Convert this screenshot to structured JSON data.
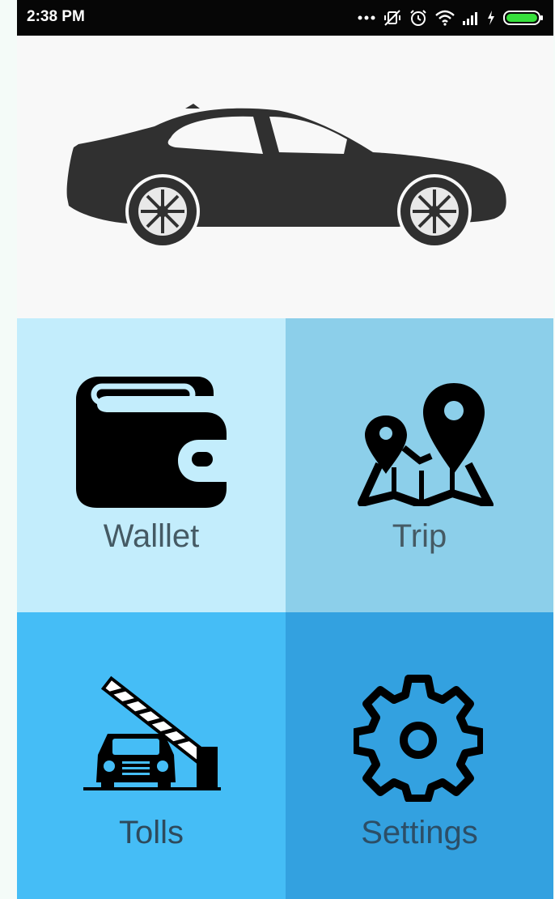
{
  "status_bar": {
    "time": "2:38 PM",
    "icons": [
      "more-dots-icon",
      "vibrate-off-icon",
      "alarm-icon",
      "wifi-icon",
      "signal-icon",
      "charging-icon",
      "battery-icon"
    ]
  },
  "hero": {
    "image": "car-icon"
  },
  "menu": {
    "wallet": {
      "label": "Walllet",
      "icon": "wallet-icon",
      "color": "#c3edfc"
    },
    "trip": {
      "label": "Trip",
      "icon": "map-pins-icon",
      "color": "#8ccfea"
    },
    "tolls": {
      "label": "Tolls",
      "icon": "toll-barrier-icon",
      "color": "#45bdf6"
    },
    "settings": {
      "label": "Settings",
      "icon": "gear-icon",
      "color": "#33a1e0"
    }
  }
}
